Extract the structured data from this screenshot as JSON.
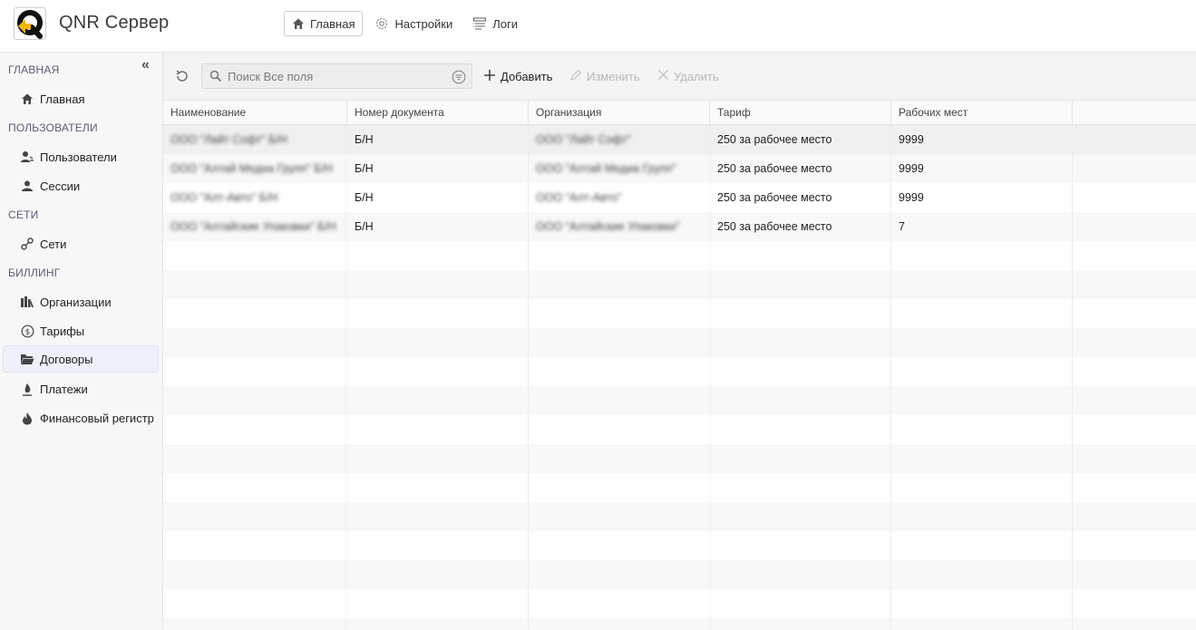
{
  "app": {
    "title": "QNR Сервер"
  },
  "topnav": [
    {
      "label": "Главная",
      "icon": "home-icon"
    },
    {
      "label": "Настройки",
      "icon": "gear-icon"
    },
    {
      "label": "Логи",
      "icon": "list-icon"
    }
  ],
  "sidebar": {
    "sections": [
      {
        "title": "ГЛАВНАЯ",
        "items": [
          {
            "label": "Главная",
            "icon": "home-icon"
          }
        ]
      },
      {
        "title": "ПОЛЬЗОВАТЕЛИ",
        "items": [
          {
            "label": "Пользователи",
            "icon": "users-icon"
          },
          {
            "label": "Сессии",
            "icon": "user-icon"
          }
        ]
      },
      {
        "title": "СЕТИ",
        "items": [
          {
            "label": "Сети",
            "icon": "network-icon"
          }
        ]
      },
      {
        "title": "БИЛЛИНГ",
        "items": [
          {
            "label": "Организации",
            "icon": "building-icon"
          },
          {
            "label": "Тарифы",
            "icon": "dollar-icon"
          },
          {
            "label": "Договоры",
            "icon": "folder-icon"
          },
          {
            "label": "Платежи",
            "icon": "payment-icon"
          },
          {
            "label": "Финансовый регистр",
            "icon": "fire-icon"
          }
        ]
      }
    ],
    "active": "Договоры"
  },
  "toolbar": {
    "search_placeholder": "Поиск Все поля",
    "add": "Добавить",
    "edit": "Изменить",
    "delete": "Удалить"
  },
  "table": {
    "columns": [
      "Наименование",
      "Номер документа",
      "Организация",
      "Тариф",
      "Рабочих мест"
    ],
    "rows": [
      {
        "name": "ООО \"Лайт Софт\" Б/Н",
        "doc": "Б/Н",
        "org": "ООО \"Лайт Софт\"",
        "tariff": "250 за рабочее место",
        "seats": "9999"
      },
      {
        "name": "ООО \"Алтай Медиа Групп\" Б/Н",
        "doc": "Б/Н",
        "org": "ООО \"Алтай Медиа Групп\"",
        "tariff": "250 за рабочее место",
        "seats": "9999"
      },
      {
        "name": "ООО \"Алт-Авто\" Б/Н",
        "doc": "Б/Н",
        "org": "ООО \"Алт-Авто\"",
        "tariff": "250 за рабочее место",
        "seats": "9999"
      },
      {
        "name": "ООО \"Алтайские Упаковки\" Б/Н",
        "doc": "Б/Н",
        "org": "ООО \"Алтайские Упаковки\"",
        "tariff": "250 за рабочее место",
        "seats": "7"
      }
    ]
  }
}
